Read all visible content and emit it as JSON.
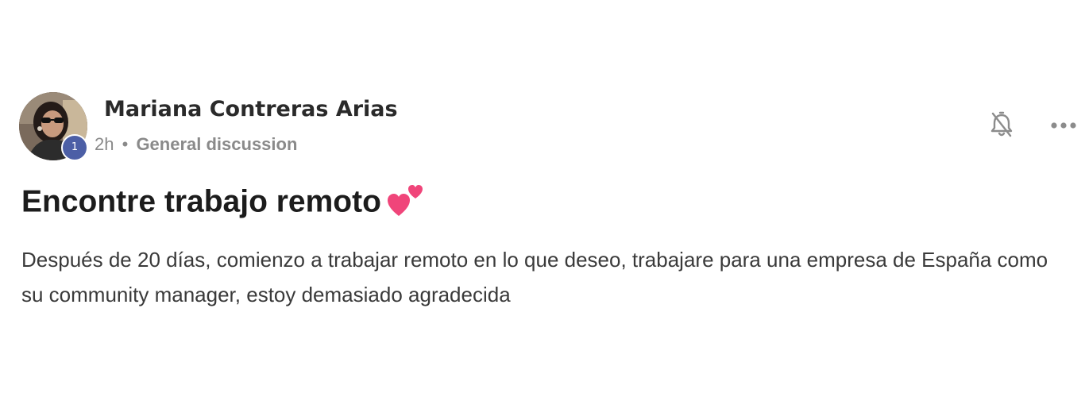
{
  "post": {
    "author": {
      "name": "Mariana Contreras Arias",
      "level": "1"
    },
    "time": "2h",
    "separator": "•",
    "category": "General discussion",
    "title": "Encontre trabajo remoto",
    "title_emoji": "two-hearts-emoji",
    "body": "Después de 20 días, comienzo a trabajar remoto en lo que deseo, trabajare para una empresa de España como su community manager, estoy demasiado agradecida"
  },
  "actions": {
    "notifications_icon": "bell-off-icon",
    "more_icon": "more-horizontal-icon"
  },
  "colors": {
    "badge": "#4c5fa6",
    "heart": "#f0457a",
    "meta_text": "#8a8a8a"
  }
}
